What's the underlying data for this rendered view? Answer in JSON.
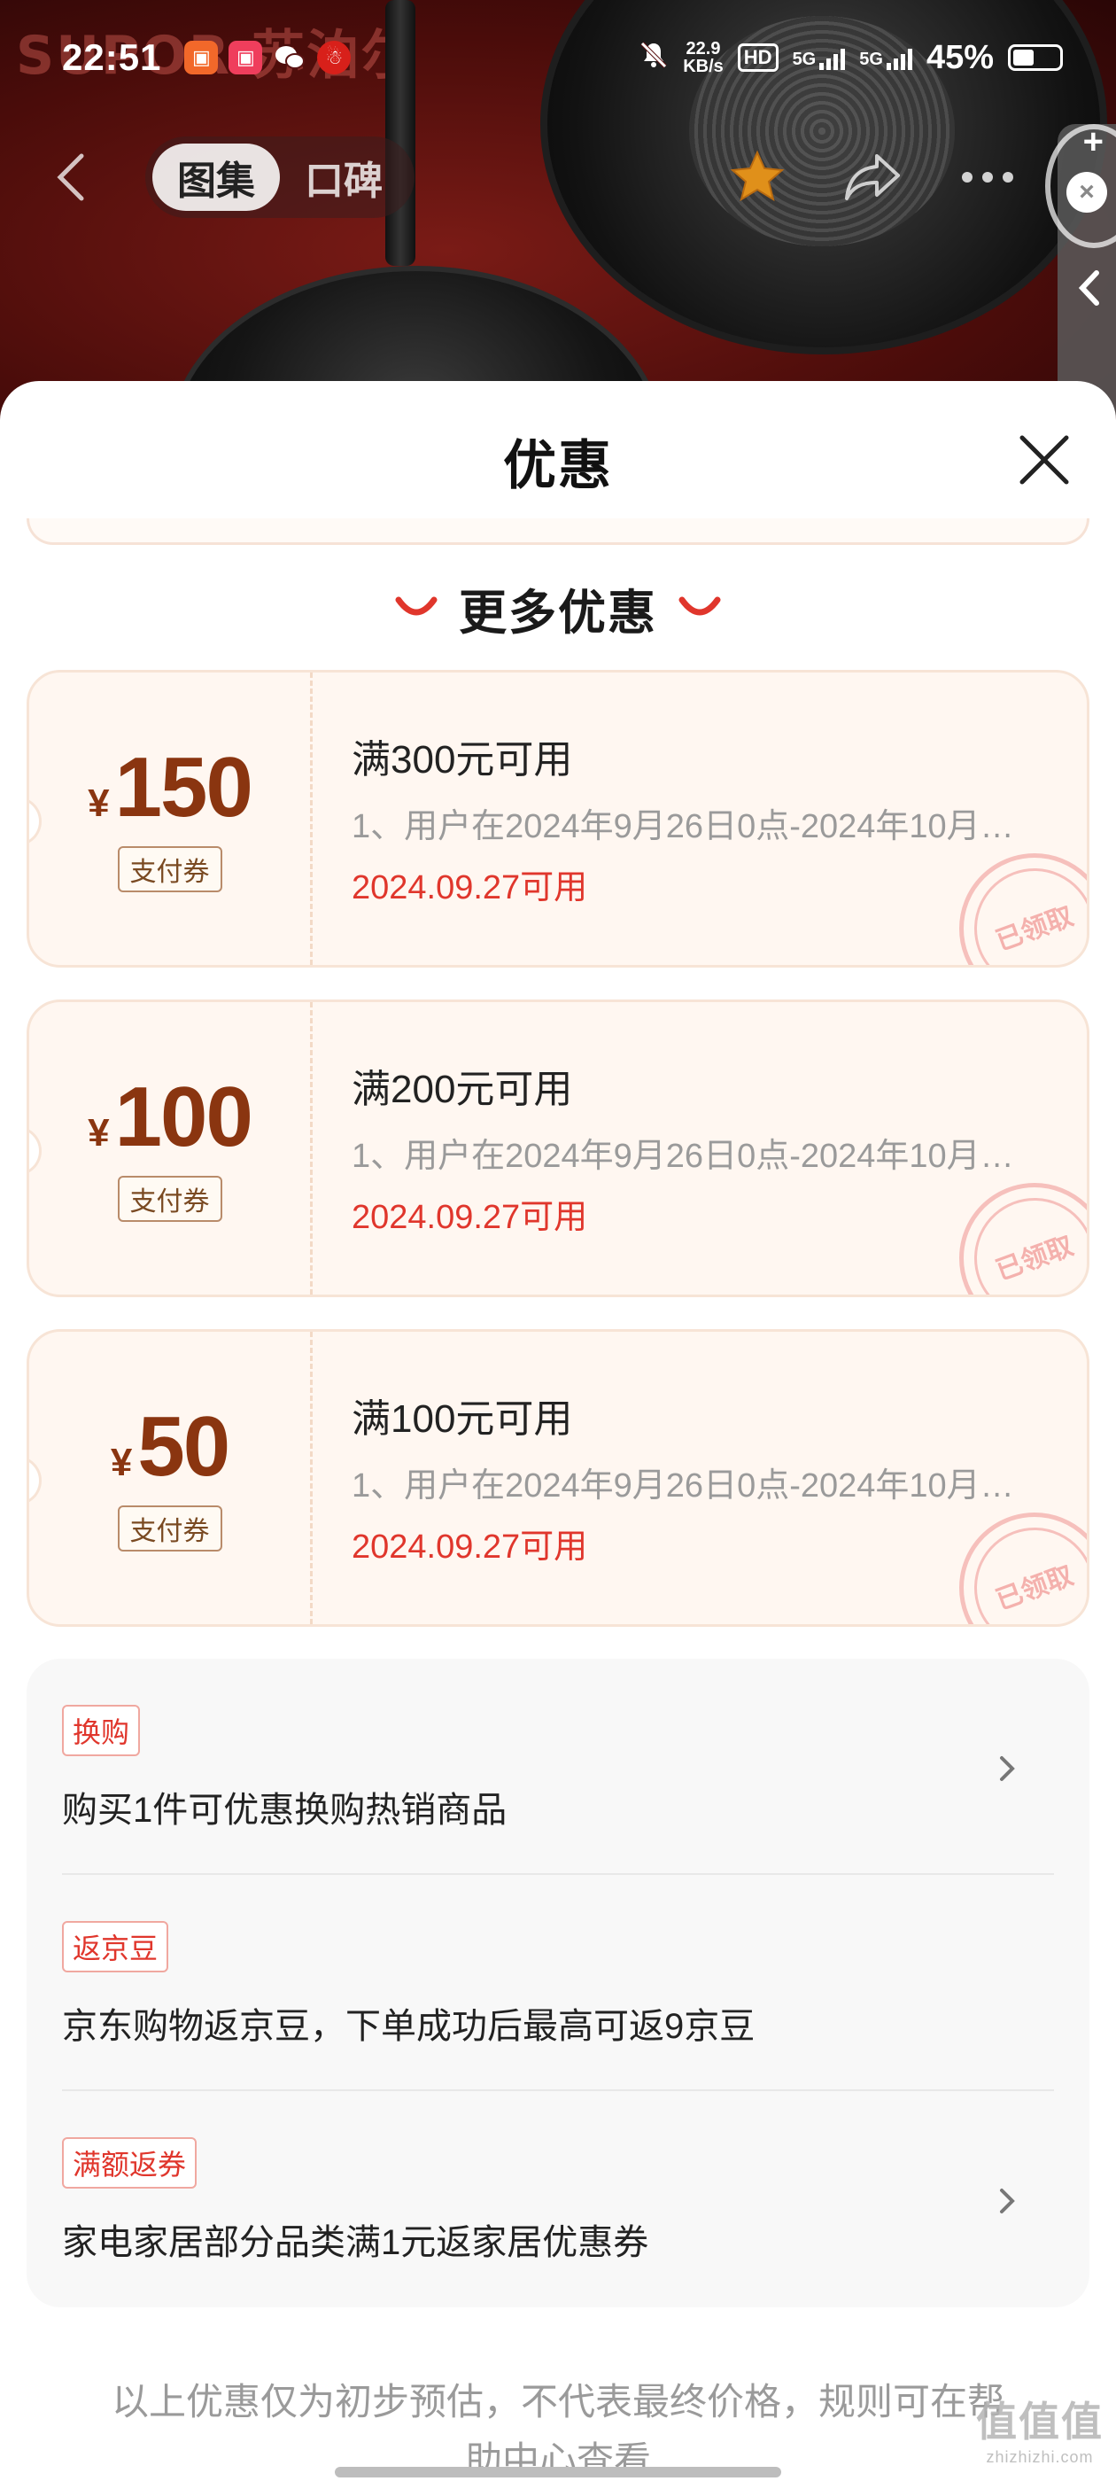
{
  "status_bar": {
    "time": "22:51",
    "net_speed_value": "22.9",
    "net_speed_unit": "KB/s",
    "hd_label": "HD",
    "network_1": "5G",
    "network_2": "5G",
    "battery_percent": "45%",
    "battery_level": 0.45
  },
  "background": {
    "brand_text": "SUPOR 苏泊尔"
  },
  "top_nav": {
    "tabs": [
      {
        "label": "图集",
        "active": true
      },
      {
        "label": "口碑",
        "active": false
      }
    ]
  },
  "float_widget": {
    "plus_icon": "+",
    "close_icon": "×"
  },
  "sheet": {
    "title": "优惠",
    "section_title": "更多优惠",
    "coupons": [
      {
        "currency": "¥",
        "amount": "150",
        "tag": "支付券",
        "condition": "满300元可用",
        "description": "1、用户在2024年9月26日0点-2024年10月…",
        "date": "2024.09.27可用",
        "stamp": "已领取"
      },
      {
        "currency": "¥",
        "amount": "100",
        "tag": "支付券",
        "condition": "满200元可用",
        "description": "1、用户在2024年9月26日0点-2024年10月…",
        "date": "2024.09.27可用",
        "stamp": "已领取"
      },
      {
        "currency": "¥",
        "amount": "50",
        "tag": "支付券",
        "condition": "满100元可用",
        "description": "1、用户在2024年9月26日0点-2024年10月…",
        "date": "2024.09.27可用",
        "stamp": "已领取"
      }
    ],
    "benefits": [
      {
        "tag": "换购",
        "text": "购买1件可优惠换购热销商品",
        "has_arrow": true
      },
      {
        "tag": "返京豆",
        "text": "京东购物返京豆，下单成功后最高可返9京豆",
        "has_arrow": false
      },
      {
        "tag": "满额返券",
        "text": "家电家居部分品类满1元返家居优惠券",
        "has_arrow": true
      }
    ],
    "disclaimer": "以上优惠仅为初步预估，不代表最终价格，规则可在帮助中心查看"
  },
  "watermark": {
    "logo": "值值值",
    "url": "zhizhizhi.com"
  },
  "colors": {
    "accent_red": "#e0362c",
    "coupon_brown": "#8a3510",
    "coupon_bg": "#fff7f1"
  }
}
